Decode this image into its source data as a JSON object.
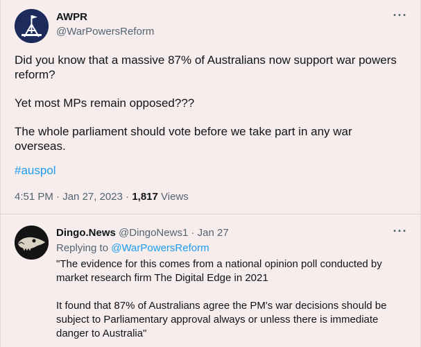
{
  "main_tweet": {
    "author_name": "AWPR",
    "author_handle": "@WarPowersReform",
    "paragraphs": [
      "Did you know that a massive 87% of Australians now support war powers reform?",
      "Yet most MPs remain opposed???",
      "The whole parliament should vote before we take part in any war overseas."
    ],
    "hashtag": "#auspol",
    "time": "4:51 PM",
    "date": "Jan 27, 2023",
    "views_count": "1,817",
    "views_label": "Views",
    "separator": "·",
    "more_icon": "···"
  },
  "reply": {
    "author_name": "Dingo.News",
    "author_handle": "@DingoNews1",
    "separator": "·",
    "date": "Jan 27",
    "replying_label": "Replying to",
    "replying_to": "@WarPowersReform",
    "paragraphs": [
      "\"The evidence for this comes from a national opinion poll conducted by market research firm The Digital Edge in 2021",
      "It found that 87% of Australians agree the PM's war decisions should be subject to Parliamentary approval always or unless there is immediate danger to Australia\""
    ],
    "more_icon": "···"
  },
  "colors": {
    "background": "#f7eded",
    "link": "#1d9bf0",
    "secondary_text": "#536471",
    "awpr_avatar_bg": "#1d2a5c"
  },
  "icons": {
    "awpr_avatar": "parliament-flag-icon",
    "dingo_avatar": "dingo-skull-icon",
    "more": "more-options-icon"
  }
}
